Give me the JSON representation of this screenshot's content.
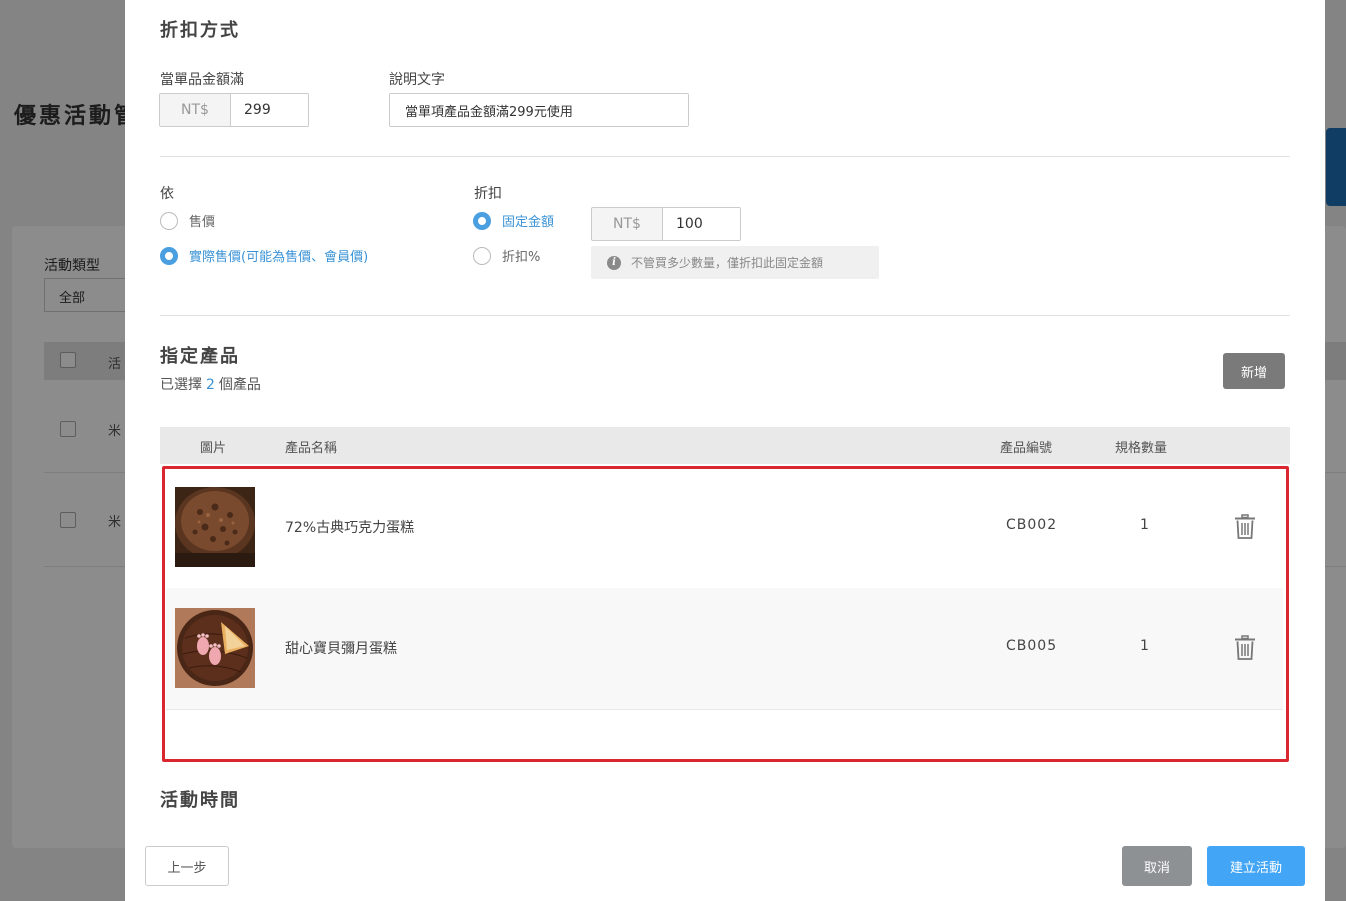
{
  "background": {
    "page_title": "優惠活動管理",
    "filter_label": "活動類型",
    "filter_value": "全部",
    "header_col": "活",
    "row1_text": "米",
    "row2_text": "米"
  },
  "discount_method": {
    "title": "折扣方式",
    "threshold_label": "當單品金額滿",
    "threshold_currency": "NT$",
    "threshold_value": "299",
    "desc_label": "說明文字",
    "desc_value": "當單項產品金額滿299元使用"
  },
  "basis": {
    "label": "依",
    "options": [
      {
        "label": "售價",
        "selected": false
      },
      {
        "label": "實際售價(可能為售價、會員價)",
        "selected": true
      }
    ]
  },
  "discount": {
    "label": "折扣",
    "options": [
      {
        "label": "固定金額",
        "selected": true
      },
      {
        "label": "折扣%",
        "selected": false
      }
    ],
    "currency": "NT$",
    "amount": "100",
    "hint": "不管買多少數量，僅折扣此固定金額"
  },
  "products": {
    "title": "指定產品",
    "selected_prefix": "已選擇",
    "selected_count": "2",
    "selected_suffix": "個產品",
    "add_button": "新增",
    "columns": {
      "image": "圖片",
      "name": "產品名稱",
      "code": "產品編號",
      "spec_count": "規格數量"
    },
    "rows": [
      {
        "name": "72%古典巧克力蛋糕",
        "code": "CB002",
        "spec_count": "1"
      },
      {
        "name": "甜心寶貝彌月蛋糕",
        "code": "CB005",
        "spec_count": "1"
      }
    ]
  },
  "schedule": {
    "title": "活動時間"
  },
  "footer": {
    "back_button": "上一步",
    "cancel_button": "取消",
    "submit_button": "建立活動"
  },
  "colors": {
    "accent": "#42a5f5",
    "highlight_border": "#d9262f",
    "radio_selected": "#4a9fe0"
  }
}
